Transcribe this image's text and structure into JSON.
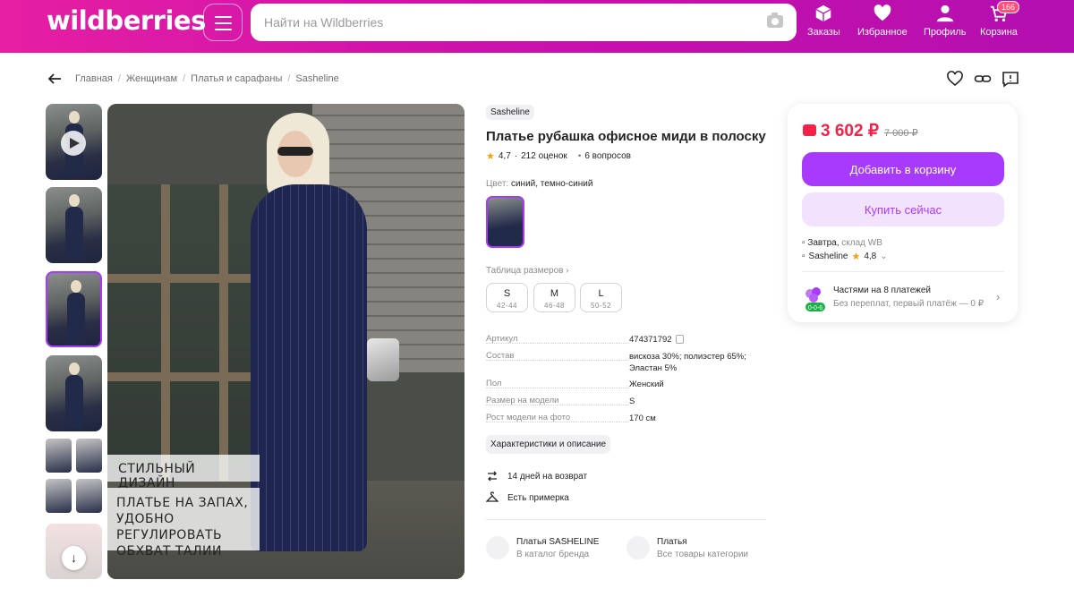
{
  "header": {
    "logo": "wildberries",
    "search_placeholder": "Найти на Wildberries",
    "nav": [
      {
        "label": "Заказы",
        "icon": "box-icon"
      },
      {
        "label": "Избранное",
        "icon": "heart-icon"
      },
      {
        "label": "Профиль",
        "icon": "user-icon"
      },
      {
        "label": "Корзина",
        "icon": "cart-icon"
      }
    ],
    "cart_badge": "166"
  },
  "breadcrumb": [
    "Главная",
    "Женщинам",
    "Платья и сарафаны",
    "Sasheline"
  ],
  "gallery": {
    "overlay_1": "СТИЛЬНЫЙ ДИЗАЙН",
    "overlay_2": "ПЛАТЬЕ НА ЗАПАХ,\nУДОБНО РЕГУЛИРОВАТЬ\nОБХВАТ ТАЛИИ"
  },
  "product": {
    "brand": "Sasheline",
    "title": "Платье рубашка офисное миди в полоску",
    "rating": "4,7",
    "reviews": "212 оценок",
    "questions": "6 вопросов",
    "color_label": "Цвет:",
    "color_value": "синий, темно-синий",
    "size_table_link": "Таблица размеров",
    "sizes": [
      {
        "size": "S",
        "range": "42-44"
      },
      {
        "size": "M",
        "range": "46-48"
      },
      {
        "size": "L",
        "range": "50-52"
      }
    ],
    "specs": [
      {
        "key": "Артикул",
        "value": "474371792"
      },
      {
        "key": "Состав",
        "value": "вискоза 30%; полиэстер 65%; Эластан 5%"
      },
      {
        "key": "Пол",
        "value": "Женский"
      },
      {
        "key": "Размер на модели",
        "value": "S"
      },
      {
        "key": "Рост модели на фото",
        "value": "170 см"
      }
    ],
    "char_button": "Характеристики и описание",
    "perks": [
      "14 дней на возврат",
      "Есть примерка"
    ],
    "links": [
      {
        "title": "Платья SASHELINE",
        "subtitle": "В каталог бренда"
      },
      {
        "title": "Платья",
        "subtitle": "Все товары категории"
      }
    ]
  },
  "price_card": {
    "price": "3 602 ₽",
    "old_price": "7 000 ₽",
    "add_to_cart": "Добавить в корзину",
    "buy_now": "Купить сейчас",
    "delivery": "Завтра,",
    "warehouse": "склад WB",
    "seller": "Sasheline",
    "seller_rating": "4,8",
    "installment_title": "Частями на 8 платежей",
    "installment_sub": "Без переплат, первый платёж — 0 ₽",
    "installment_badge": "0-0-6"
  },
  "colors": {
    "accent": "#a73afd",
    "price": "#f4224a",
    "header_start": "#e61fa3",
    "header_end": "#b40fb0"
  }
}
